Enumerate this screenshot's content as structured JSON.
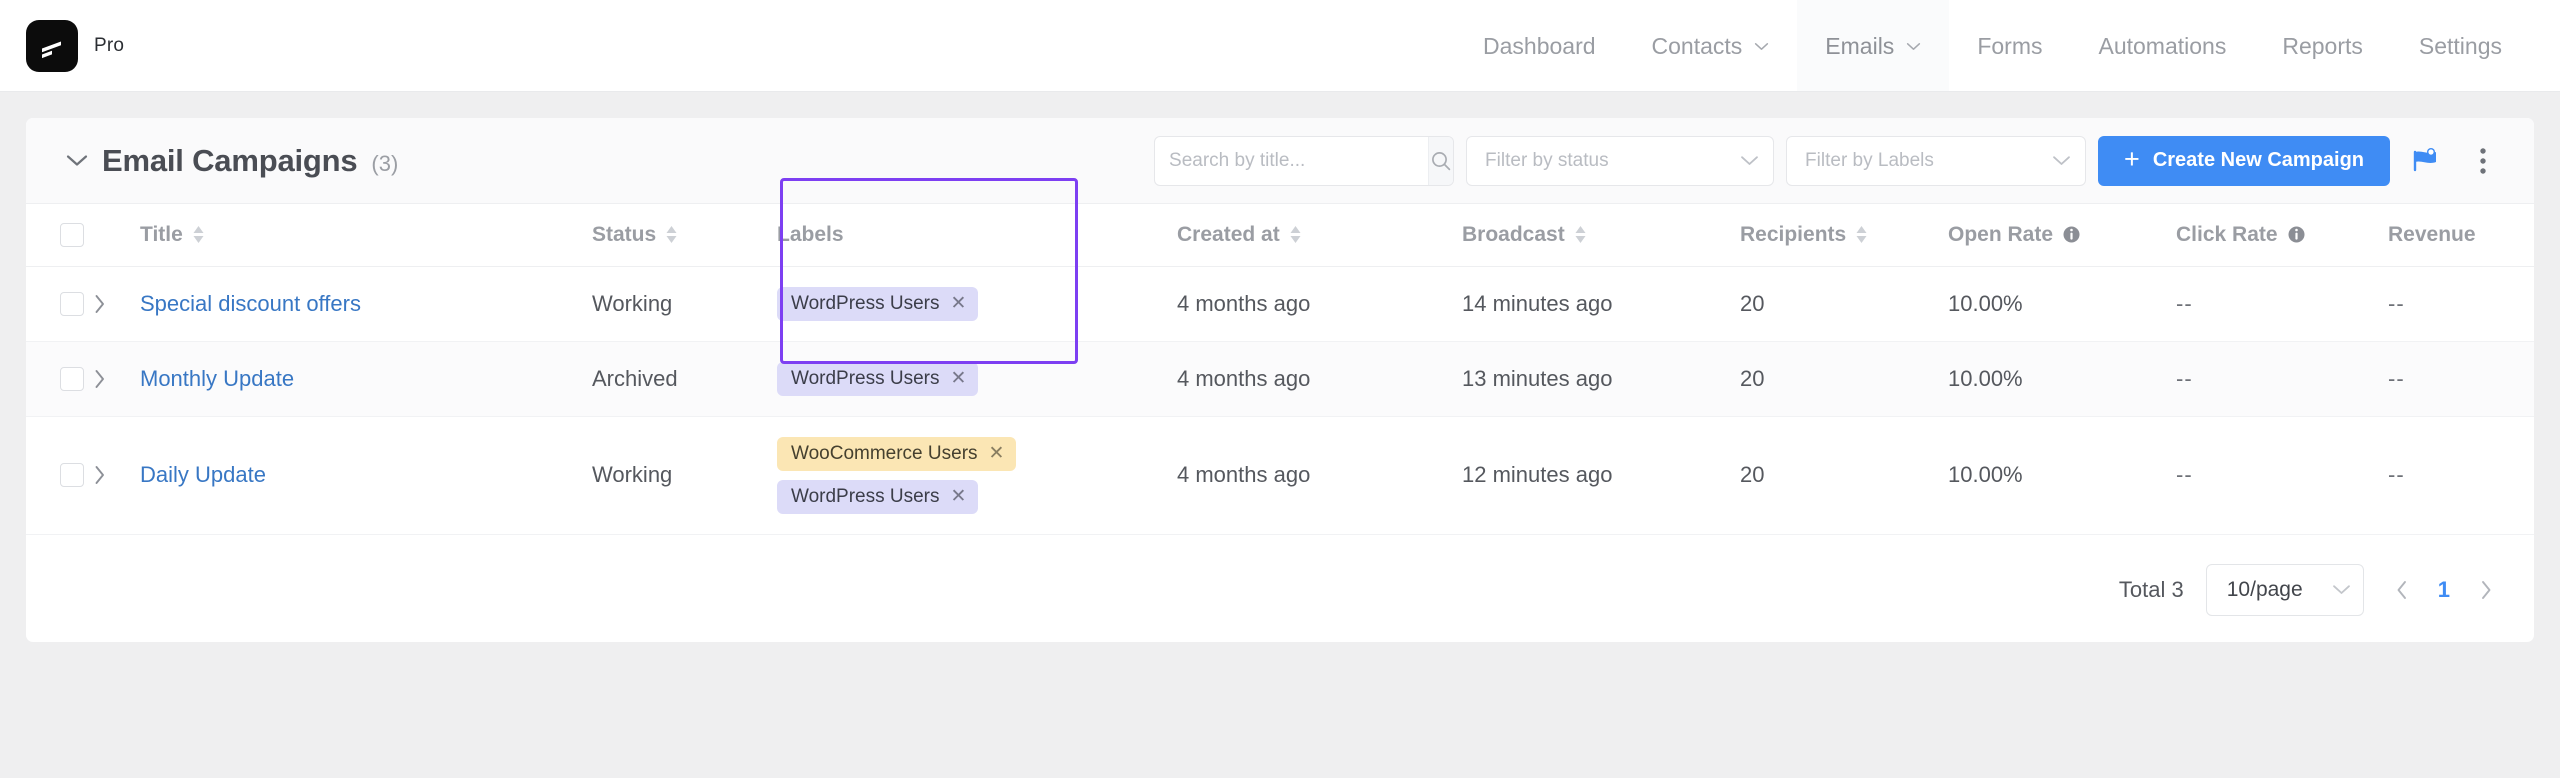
{
  "brand": {
    "name": "Pro",
    "logo_icon": "fluent-crm-logo-icon"
  },
  "nav": {
    "items": [
      {
        "label": "Dashboard",
        "has_caret": false,
        "active": false
      },
      {
        "label": "Contacts",
        "has_caret": true,
        "active": false
      },
      {
        "label": "Emails",
        "has_caret": true,
        "active": true
      },
      {
        "label": "Forms",
        "has_caret": false,
        "active": false
      },
      {
        "label": "Automations",
        "has_caret": false,
        "active": false
      },
      {
        "label": "Reports",
        "has_caret": false,
        "active": false
      },
      {
        "label": "Settings",
        "has_caret": false,
        "active": false
      }
    ]
  },
  "header": {
    "title": "Email Campaigns",
    "count": "(3)",
    "collapse_icon": "chevron-down-icon"
  },
  "toolbar": {
    "search_placeholder": "Search by title...",
    "search_value": "",
    "search_icon": "search-icon",
    "status_filter": "Filter by status",
    "labels_filter": "Filter by Labels",
    "create_label": "Create New Campaign",
    "create_plus": "+",
    "accent_color": "#3f8cf4",
    "help_icon": "graduation-cap-icon",
    "more_icon": "vertical-dots-icon"
  },
  "table": {
    "columns": [
      {
        "label": "Title",
        "sortable": true,
        "info": false
      },
      {
        "label": "Status",
        "sortable": true,
        "info": false
      },
      {
        "label": "Labels",
        "sortable": false,
        "info": false
      },
      {
        "label": "Created at",
        "sortable": true,
        "info": false
      },
      {
        "label": "Broadcast",
        "sortable": true,
        "info": false
      },
      {
        "label": "Recipients",
        "sortable": true,
        "info": false
      },
      {
        "label": "Open Rate",
        "sortable": false,
        "info": true
      },
      {
        "label": "Click Rate",
        "sortable": false,
        "info": true
      },
      {
        "label": "Revenue",
        "sortable": false,
        "info": false
      }
    ],
    "rows": [
      {
        "title": "Special discount offers",
        "status": "Working",
        "labels": [
          {
            "text": "WordPress Users",
            "color": "violet"
          }
        ],
        "created_at": "4 months ago",
        "broadcast": "14 minutes ago",
        "recipients": "20",
        "open_rate": "10.00%",
        "click_rate": "--",
        "revenue": "--"
      },
      {
        "title": "Monthly Update",
        "status": "Archived",
        "labels": [
          {
            "text": "WordPress Users",
            "color": "violet"
          }
        ],
        "created_at": "4 months ago",
        "broadcast": "13 minutes ago",
        "recipients": "20",
        "open_rate": "10.00%",
        "click_rate": "--",
        "revenue": "--"
      },
      {
        "title": "Daily Update",
        "status": "Working",
        "labels": [
          {
            "text": "WooCommerce Users",
            "color": "amber"
          },
          {
            "text": "WordPress Users",
            "color": "violet"
          }
        ],
        "created_at": "4 months ago",
        "broadcast": "12 minutes ago",
        "recipients": "20",
        "open_rate": "10.00%",
        "click_rate": "--",
        "revenue": "--"
      }
    ]
  },
  "footer": {
    "total": "Total 3",
    "page_size": "10/page",
    "current_page": "1",
    "prev_icon": "chevron-left-icon",
    "next_icon": "chevron-right-icon"
  },
  "annotation": {
    "highlight_color": "#7d3ff2",
    "target": "labels-column"
  }
}
